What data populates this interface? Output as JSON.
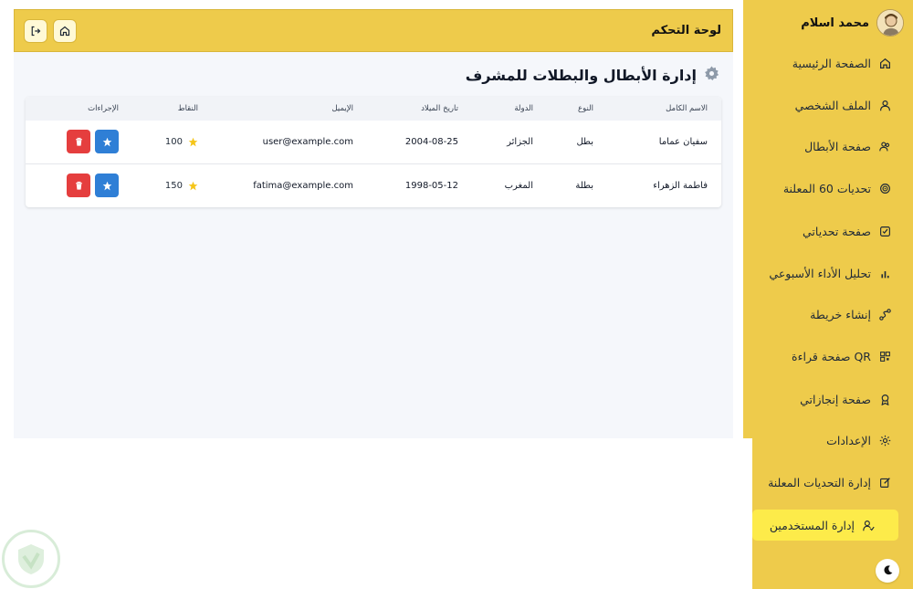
{
  "user": {
    "name": "محمد اسلام"
  },
  "sidebar": {
    "items": [
      {
        "label": "الصفحة الرئيسية",
        "icon": "home-icon"
      },
      {
        "label": "الملف الشخصي",
        "icon": "user-icon"
      },
      {
        "label": "صفحة الأبطال",
        "icon": "users-icon"
      },
      {
        "label": "تحديات 60 المعلنة",
        "icon": "target-icon"
      },
      {
        "label": "صفحة تحدياتي",
        "icon": "checkbox-icon"
      },
      {
        "label": "تحليل الأداء الأسبوعي",
        "icon": "bar-chart-icon"
      },
      {
        "label": "إنشاء خريطة",
        "icon": "route-icon"
      },
      {
        "label": "صفحة قراءة QR",
        "icon": "qr-icon"
      },
      {
        "label": "صفحة إنجازاتي",
        "icon": "award-icon"
      },
      {
        "label": "الإعدادات",
        "icon": "gear-icon"
      },
      {
        "label": "إدارة التحديات المعلنة",
        "icon": "edit-icon"
      },
      {
        "label": "إدارة المستخدمين",
        "icon": "user-check-icon",
        "active": true
      }
    ]
  },
  "topbar": {
    "title": "لوحة التحكم"
  },
  "page": {
    "title": "إدارة الأبطال والبطلات للمشرف"
  },
  "table": {
    "headers": {
      "name": "الاسم الكامل",
      "type": "النوع",
      "country": "الدولة",
      "birthdate": "تاريخ الميلاد",
      "email": "الإيميل",
      "points": "النقاط",
      "actions": "الإجراءات"
    },
    "rows": [
      {
        "name": "سفيان عماما",
        "type": "بطل",
        "country": "الجزائر",
        "birthdate": "2004-08-25",
        "email": "user@example.com",
        "points": "100"
      },
      {
        "name": "فاطمة الزهراء",
        "type": "بطلة",
        "country": "المغرب",
        "birthdate": "1998-05-12",
        "email": "fatima@example.com",
        "points": "150"
      }
    ]
  },
  "colors": {
    "accent": "#eecb4b",
    "active": "#fdeb4a",
    "blue": "#2f7fd6",
    "red": "#e53e3e",
    "star": "#f5c518"
  }
}
